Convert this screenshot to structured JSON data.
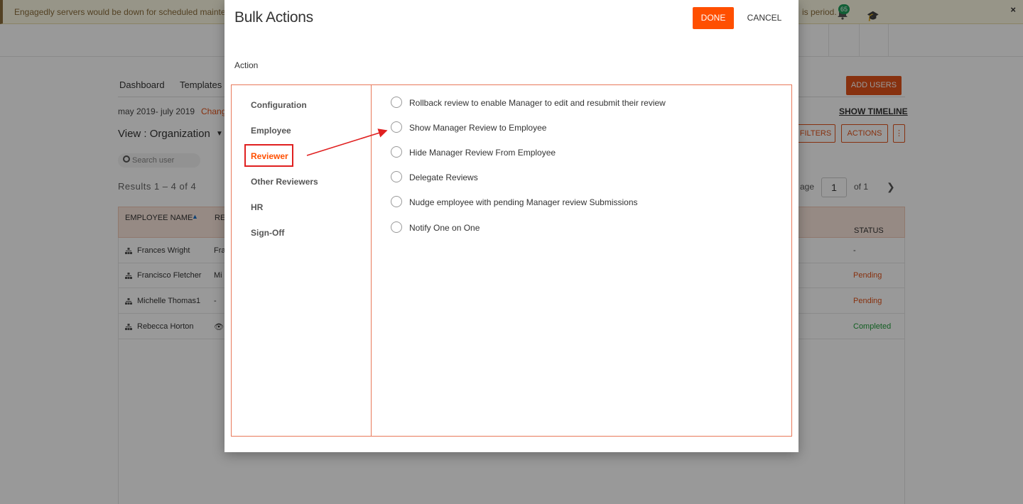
{
  "banner": {
    "text_left": "Engagedly servers would be down for scheduled maintena",
    "text_right": "is period.",
    "close_label": "×"
  },
  "topbar": {
    "notification_count": "65"
  },
  "background": {
    "nav": [
      "Dashboard",
      "Templates"
    ],
    "period": "may 2019- july 2019",
    "change_label": "Chang",
    "view_label": "View : Organization",
    "search_placeholder": "Search user",
    "results": "Results  1 – 4 of 4",
    "add_users": "ADD USERS",
    "show_timeline": "SHOW TIMELINE",
    "filters": "FILTERS",
    "actions": "ACTIONS",
    "more": "⋮",
    "page_label": "age",
    "page_value": "1",
    "page_of": "of 1",
    "table_headers": {
      "employee_name": "EMPLOYEE NAME",
      "reviewer": "RE",
      "status": "STATUS"
    },
    "rows": [
      {
        "name": "Frances Wright",
        "reviewer": "Fra",
        "status": "-",
        "status_color": "#333333"
      },
      {
        "name": "Francisco Fletcher",
        "reviewer": "Mi",
        "status": "Pending",
        "status_color": "#e25219"
      },
      {
        "name": "Michelle Thomas1",
        "reviewer": "-",
        "status": "Pending",
        "status_color": "#e25219"
      },
      {
        "name": "Rebecca Horton",
        "reviewer": "👁",
        "status": "Completed",
        "status_color": "#1f9d3a"
      }
    ]
  },
  "modal": {
    "title": "Bulk Actions",
    "done_label": "DONE",
    "cancel_label": "CANCEL",
    "action_label": "Action",
    "categories": [
      {
        "label": "Configuration",
        "active": false
      },
      {
        "label": "Employee",
        "active": false
      },
      {
        "label": "Reviewer",
        "active": true
      },
      {
        "label": "Other Reviewers",
        "active": false
      },
      {
        "label": "HR",
        "active": false
      },
      {
        "label": "Sign-Off",
        "active": false
      }
    ],
    "options": [
      {
        "label": "Rollback review to enable Manager to edit and resubmit their review",
        "selected": false
      },
      {
        "label": "Show Manager Review to Employee",
        "selected": false
      },
      {
        "label": "Hide Manager Review From Employee",
        "selected": false
      },
      {
        "label": "Delegate Reviews",
        "selected": false
      },
      {
        "label": "Nudge employee with pending Manager review Submissions",
        "selected": false
      },
      {
        "label": "Notify One on One",
        "selected": false
      }
    ]
  },
  "colors": {
    "accent": "#ff4f00",
    "annotation_red": "#e02020",
    "panel_border": "#e8795a"
  }
}
